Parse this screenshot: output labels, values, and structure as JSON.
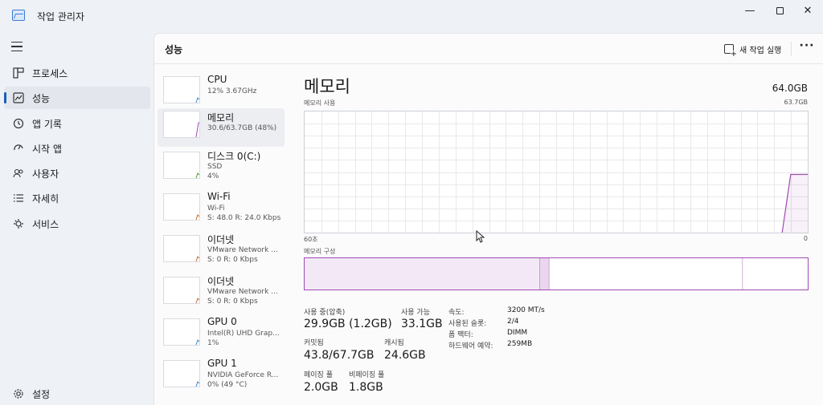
{
  "window": {
    "title": "작업 관리자",
    "controls": {
      "minimize": "—",
      "close": "✕"
    }
  },
  "sidebar": {
    "items": [
      {
        "label": "프로세스",
        "icon": "processes-icon"
      },
      {
        "label": "성능",
        "icon": "performance-icon",
        "active": true
      },
      {
        "label": "앱 기록",
        "icon": "history-icon"
      },
      {
        "label": "시작 앱",
        "icon": "startup-icon"
      },
      {
        "label": "사용자",
        "icon": "users-icon"
      },
      {
        "label": "자세히",
        "icon": "details-icon"
      },
      {
        "label": "서비스",
        "icon": "services-icon"
      }
    ],
    "settings_label": "설정"
  },
  "header": {
    "title": "성능",
    "new_task_label": "새 작업 실행",
    "more_label": "···"
  },
  "devices": [
    {
      "name": "CPU",
      "line1": "12% 3.67GHz",
      "line2": "",
      "color": "#3a86c8"
    },
    {
      "name": "메모리",
      "line1": "30.6/63.7GB (48%)",
      "line2": "",
      "color": "#a04bb2",
      "active": true
    },
    {
      "name": "디스크 0(C:)",
      "line1": "SSD",
      "line2": "4%",
      "color": "#4c9a2a"
    },
    {
      "name": "Wi-Fi",
      "line1": "Wi-Fi",
      "line2": "S: 48.0  R: 24.0 Kbps",
      "color": "#c36a2d"
    },
    {
      "name": "이더넷",
      "line1": "VMware Network ...",
      "line2": "S: 0  R: 0 Kbps",
      "color": "#c36a2d"
    },
    {
      "name": "이더넷",
      "line1": "VMware Network ...",
      "line2": "S: 0  R: 0 Kbps",
      "color": "#c36a2d"
    },
    {
      "name": "GPU 0",
      "line1": "Intel(R) UHD Grap...",
      "line2": "1%",
      "color": "#3a86c8"
    },
    {
      "name": "GPU 1",
      "line1": "NVIDIA GeForce R...",
      "line2": "0% (49 °C)",
      "color": "#3a86c8"
    }
  ],
  "detail": {
    "title": "메모리",
    "total": "64.0GB",
    "usage_label": "메모리 사용",
    "usage_max": "63.7GB",
    "axis_left": "60초",
    "axis_right": "0",
    "composition_label": "메모리 구성",
    "accent": "#a04bb2",
    "usage_history": [
      0,
      0,
      0,
      0,
      0,
      0,
      0,
      0,
      0,
      0,
      0,
      0,
      0,
      0,
      0,
      0,
      0,
      0,
      0,
      0,
      0,
      0,
      0,
      0,
      0,
      0,
      0,
      0,
      0,
      0,
      0,
      0,
      0,
      0,
      0,
      0,
      0,
      0,
      0,
      0,
      0,
      0,
      0,
      0,
      0,
      0,
      0,
      0,
      0,
      0,
      0,
      0,
      0,
      0,
      0,
      0,
      0,
      48,
      48,
      48
    ],
    "composition": {
      "in_use": 29.9,
      "modified": 1.2,
      "standby": 24.6,
      "free": 8.3
    },
    "stats": [
      {
        "label": "사용 중(압축)",
        "value": "29.9GB (1.2GB)"
      },
      {
        "label": "사용 가능",
        "value": "33.1GB"
      },
      {
        "label": "커밋됨",
        "value": "43.8/67.7GB"
      },
      {
        "label": "캐시됨",
        "value": "24.6GB"
      },
      {
        "label": "페이징 풀",
        "value": "2.0GB"
      },
      {
        "label": "비페이징 풀",
        "value": "1.8GB"
      }
    ],
    "specs": [
      {
        "key": "속도:",
        "value": "3200 MT/s"
      },
      {
        "key": "사용된 슬롯:",
        "value": "2/4"
      },
      {
        "key": "폼 팩터:",
        "value": "DIMM"
      },
      {
        "key": "하드웨어 예약:",
        "value": "259MB"
      }
    ]
  }
}
